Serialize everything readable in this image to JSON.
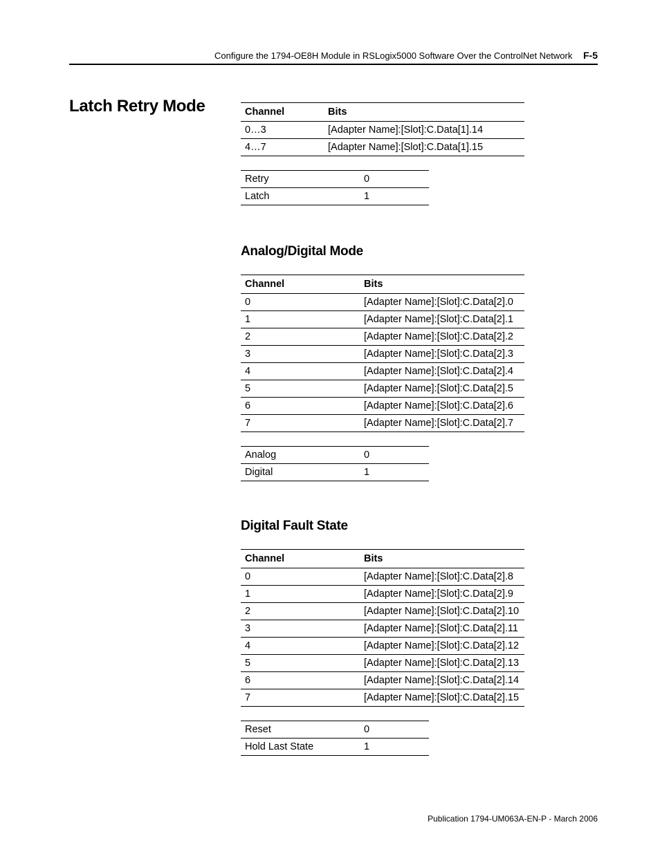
{
  "page_header": {
    "title": "Configure the 1794-OE8H Module in RSLogix5000 Software Over the ControlNet Network",
    "number": "F-5"
  },
  "section_heading": "Latch Retry Mode",
  "latch_retry": {
    "headers": {
      "c1": "Channel",
      "c2": "Bits"
    },
    "rows": [
      {
        "ch": "0…3",
        "bits": "[Adapter Name]:[Slot]:C.Data[1].14"
      },
      {
        "ch": "4…7",
        "bits": "[Adapter Name]:[Slot]:C.Data[1].15"
      }
    ],
    "lookup": [
      {
        "k": "Retry",
        "v": "0"
      },
      {
        "k": "Latch",
        "v": "1"
      }
    ]
  },
  "analog_digital": {
    "heading": "Analog/Digital Mode",
    "headers": {
      "c1": "Channel",
      "c2": "Bits"
    },
    "rows": [
      {
        "ch": "0",
        "bits": "[Adapter Name]:[Slot]:C.Data[2].0"
      },
      {
        "ch": "1",
        "bits": "[Adapter Name]:[Slot]:C.Data[2].1"
      },
      {
        "ch": "2",
        "bits": "[Adapter Name]:[Slot]:C.Data[2].2"
      },
      {
        "ch": "3",
        "bits": "[Adapter Name]:[Slot]:C.Data[2].3"
      },
      {
        "ch": "4",
        "bits": "[Adapter Name]:[Slot]:C.Data[2].4"
      },
      {
        "ch": "5",
        "bits": "[Adapter Name]:[Slot]:C.Data[2].5"
      },
      {
        "ch": "6",
        "bits": "[Adapter Name]:[Slot]:C.Data[2].6"
      },
      {
        "ch": "7",
        "bits": "[Adapter Name]:[Slot]:C.Data[2].7"
      }
    ],
    "lookup": [
      {
        "k": "Analog",
        "v": "0"
      },
      {
        "k": "Digital",
        "v": "1"
      }
    ]
  },
  "digital_fault": {
    "heading": "Digital Fault State",
    "headers": {
      "c1": "Channel",
      "c2": "Bits"
    },
    "rows": [
      {
        "ch": "0",
        "bits": "[Adapter Name]:[Slot]:C.Data[2].8"
      },
      {
        "ch": "1",
        "bits": "[Adapter Name]:[Slot]:C.Data[2].9"
      },
      {
        "ch": "2",
        "bits": "[Adapter Name]:[Slot]:C.Data[2].10"
      },
      {
        "ch": "3",
        "bits": "[Adapter Name]:[Slot]:C.Data[2].11"
      },
      {
        "ch": "4",
        "bits": "[Adapter Name]:[Slot]:C.Data[2].12"
      },
      {
        "ch": "5",
        "bits": "[Adapter Name]:[Slot]:C.Data[2].13"
      },
      {
        "ch": "6",
        "bits": "[Adapter Name]:[Slot]:C.Data[2].14"
      },
      {
        "ch": "7",
        "bits": "[Adapter Name]:[Slot]:C.Data[2].15"
      }
    ],
    "lookup": [
      {
        "k": "Reset",
        "v": "0"
      },
      {
        "k": "Hold Last State",
        "v": "1"
      }
    ]
  },
  "footer": "Publication 1794-UM063A-EN-P - March 2006"
}
